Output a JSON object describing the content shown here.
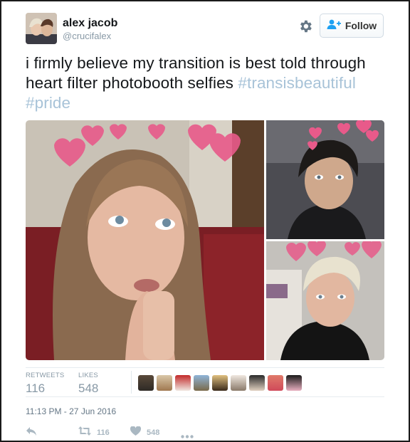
{
  "user": {
    "display_name": "alex jacob",
    "handle": "@crucifalex"
  },
  "follow_button": {
    "label": "Follow"
  },
  "tweet": {
    "text_plain": "i firmly believe my transition is best told through heart filter photobooth selfies",
    "hashtags": [
      "#transisbeautiful",
      "#pride"
    ]
  },
  "stats": {
    "retweets_label": "RETWEETS",
    "retweets_count": "116",
    "likes_label": "LIKES",
    "likes_count": "548"
  },
  "timestamp": "11:13 PM - 27 Jun 2016",
  "actions": {
    "retweet_count": "116",
    "like_count": "548"
  },
  "colors": {
    "hashtag": "#a8c3d8",
    "follow_icon": "#1da1f2",
    "muted": "#8899a6"
  },
  "icons": [
    "gear-icon",
    "follow-user-plus-icon",
    "reply-icon",
    "retweet-icon",
    "heart-icon",
    "more-dots-icon"
  ]
}
